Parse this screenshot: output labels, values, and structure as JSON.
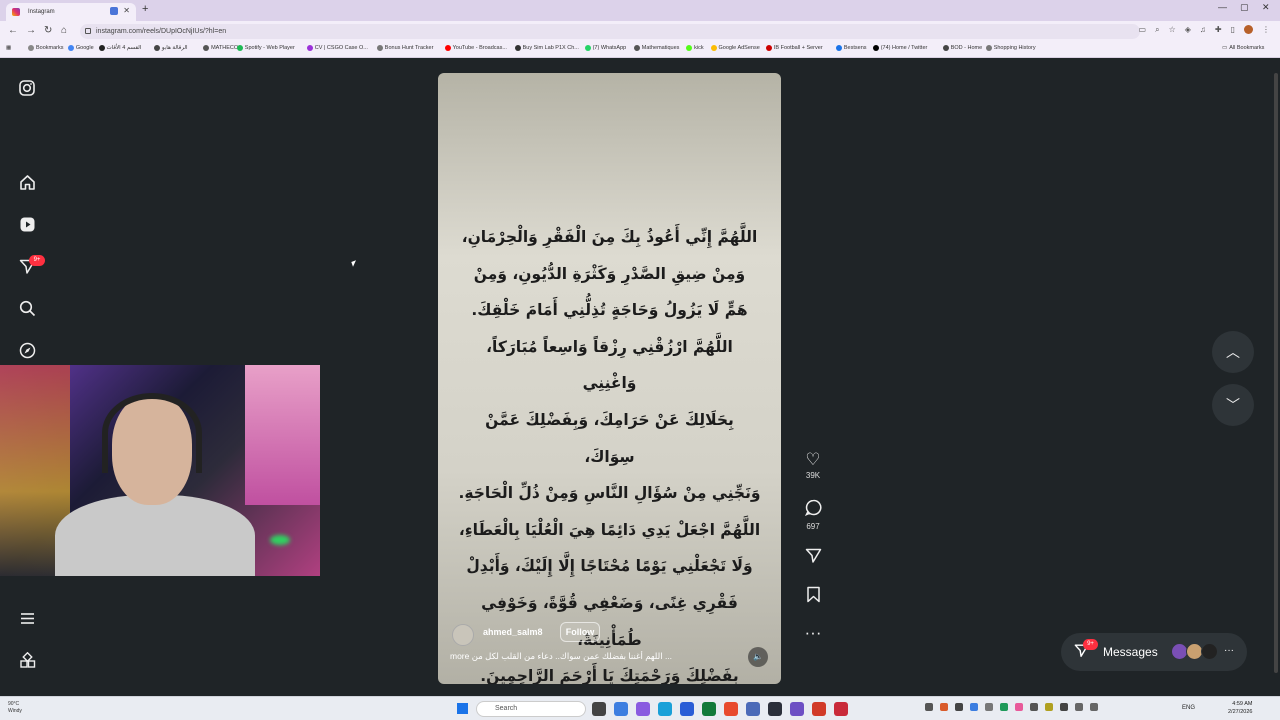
{
  "browser": {
    "tab_title": "Instagram",
    "new_tab": "+",
    "url": "instagram.com/reels/DUpIOcNjIUs/?hl=en",
    "window_controls": [
      "—",
      "▢",
      "✕"
    ],
    "bookmarks": [
      {
        "label": "Bookmarks",
        "color": "#888"
      },
      {
        "label": "Google",
        "color": "#4285f4"
      },
      {
        "label": "القسم 4 الأقات",
        "color": "#222"
      },
      {
        "label": "الرقالة هابو",
        "color": "#444"
      },
      {
        "label": "MATHECO",
        "color": "#555"
      },
      {
        "label": "Spotify - Web Player",
        "color": "#1db954"
      },
      {
        "label": "CV | CSGO Case O...",
        "color": "#9b30d9"
      },
      {
        "label": "Bonus Hunt Tracker",
        "color": "#777"
      },
      {
        "label": "YouTube - Broadcas...",
        "color": "#ff0000"
      },
      {
        "label": "Buy Sim Lab P1X Ch...",
        "color": "#333"
      },
      {
        "label": "(7) WhatsApp",
        "color": "#25d366"
      },
      {
        "label": "Mathematiques",
        "color": "#555"
      },
      {
        "label": "kick",
        "color": "#53fc18"
      },
      {
        "label": "Google AdSense",
        "color": "#fbbc04"
      },
      {
        "label": "IB Football + Server",
        "color": "#c00"
      },
      {
        "label": "Bestsens",
        "color": "#1a73e8"
      },
      {
        "label": "(74) Home / Twitter",
        "color": "#000"
      },
      {
        "label": "BOD - Home",
        "color": "#444"
      },
      {
        "label": "Shopping History",
        "color": "#777"
      }
    ],
    "all_bookmarks": "All Bookmarks"
  },
  "reel": {
    "lines": [
      "اللَّهُمَّ إِنِّي أَعُوذُ بِكَ مِنَ الْفَقْرِ وَالْحِرْمَانِ،",
      "وَمِنْ ضِيقِ الصَّدْرِ وَكَثْرَةِ الدُّيُونِ، وَمِنْ",
      "هَمٍّ لَا يَزُولُ وَحَاجَةٍ تُذِلُّنِي أَمَامَ خَلْقِكَ.",
      "اللَّهُمَّ ارْزُقْنِي رِزْقاً وَاسِعاً مُبَارَكاً، وَاغْنِنِي",
      "بِحَلَالِكَ عَنْ حَرَامِكَ، وَبِفَضْلِكَ عَمَّنْ سِوَاكَ،",
      "وَنَجِّنِي مِنْ سُؤَالِ النَّاسِ وَمِنْ ذُلِّ الْحَاجَةِ.",
      "اللَّهُمَّ اجْعَلْ يَدِي دَائِمًا هِيَ الْعُلْيَا بِالْعَطَاءِ،",
      "وَلَا تَجْعَلْنِي يَوْمًا مُحْتَاجًا إِلَّا إِلَيْكَ، وَأَبْدِلْ",
      "فَقْرِي غِنًى، وَضَعْفِي قُوَّةً، وَخَوْفِي طُمَأْنِينَةً،",
      "بِفَضْلِكَ وَرَحْمَتِكَ يَا أَرْحَمَ الرَّاحِمِينَ."
    ],
    "username": "ahmed_salm8",
    "follow_label": "Follow",
    "caption": "اللهم أغننا بفضلك عمن سواك.. دعاء من القلب لكل من ...",
    "caption_more": "more"
  },
  "actions": {
    "likes": "39K",
    "comments": "697"
  },
  "nav": {
    "notification_badge": "9+"
  },
  "messages": {
    "label": "Messages",
    "badge": "9+",
    "more": "···"
  },
  "taskbar": {
    "weather_temp": "90°C",
    "weather_desc": "Windy",
    "search_placeholder": "Search",
    "lang": "ENG",
    "time": "4:59 AM",
    "date": "2/27/2026"
  },
  "colors": {
    "accent_red": "#ff3040",
    "background": "#1f2427"
  }
}
